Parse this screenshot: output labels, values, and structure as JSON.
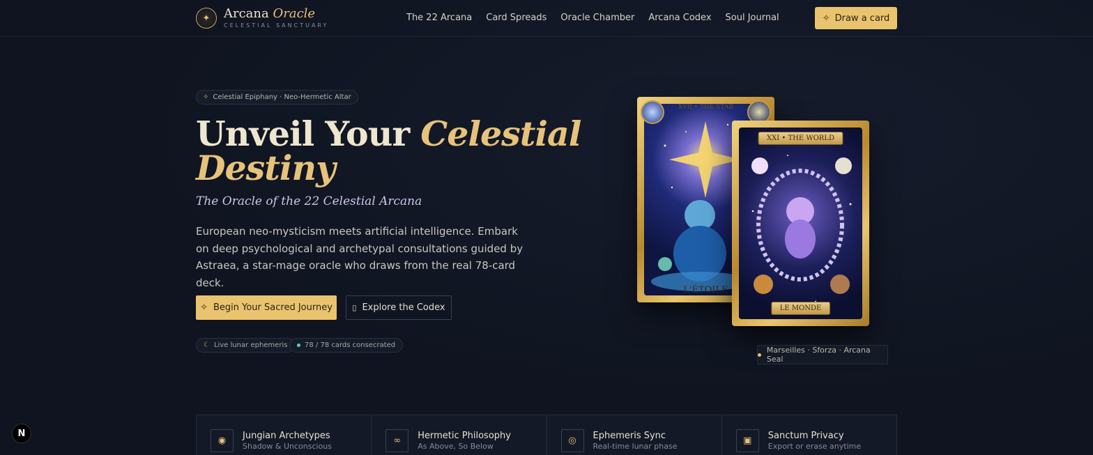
{
  "brand": {
    "name": "Arcana",
    "name_accent": "Oracle",
    "tagline": "CELESTIAL SANCTUARY"
  },
  "nav": {
    "items": [
      "The 22 Arcana",
      "Card Spreads",
      "Oracle Chamber",
      "Arcana Codex",
      "Soul Journal"
    ],
    "cta": "Draw a card"
  },
  "hero": {
    "badge": "Celestial Epiphany · Neo-Hermetic Altar",
    "title_plain": "Unveil Your",
    "title_accent_1": "Celestial",
    "title_accent_2": "Destiny",
    "subtitle": "The Oracle of the 22 Celestial Arcana",
    "description": "European neo-mysticism meets artificial intelligence. Embark on deep psychological and archetypal consultations guided by Astraea, a star-mage oracle who draws from the real 78-card deck.",
    "primary_button": "Begin Your Sacred Journey",
    "secondary_button": "Explore the Codex",
    "pills": [
      "Live lunar ephemeris",
      "78 / 78 cards consecrated"
    ]
  },
  "cards": {
    "star": {
      "header": "XVII • THE STAR",
      "name": "L'ÉTOILE"
    },
    "world": {
      "header": "XXI • THE WORLD",
      "name": "LE MONDE"
    },
    "seal": "Marseilles · Sforza · Arcana Seal"
  },
  "features": [
    {
      "icon": "brain-icon",
      "title": "Jungian Archetypes",
      "subtitle": "Shadow & Unconscious"
    },
    {
      "icon": "infinity-icon",
      "title": "Hermetic Philosophy",
      "subtitle": "As Above, So Below"
    },
    {
      "icon": "orbit-icon",
      "title": "Ephemeris Sync",
      "subtitle": "Real-time lunar phase"
    },
    {
      "icon": "lock-icon",
      "title": "Sanctum Privacy",
      "subtitle": "Export or erase anytime"
    }
  ],
  "fab": "N",
  "colors": {
    "accent": "#e9c36e",
    "background": "#0f1420",
    "teal_dot": "#5fd0c0"
  }
}
